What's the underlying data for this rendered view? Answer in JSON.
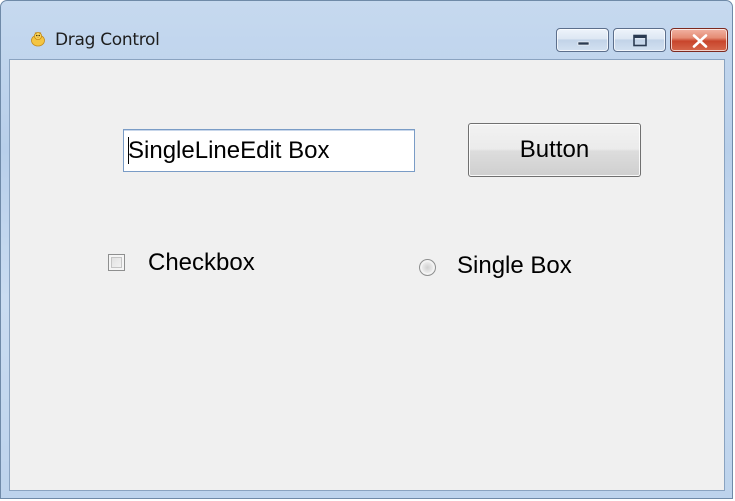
{
  "window": {
    "title": "Drag Control",
    "icon": "app-chick-icon",
    "caption_buttons": [
      "minimize-icon",
      "maximize-icon",
      "close-icon"
    ]
  },
  "content": {
    "edit_box": {
      "value": "SingleLineEdit Box"
    },
    "button": {
      "label": "Button"
    },
    "checkbox": {
      "label": "Checkbox",
      "checked": false
    },
    "radio": {
      "label": "Single Box",
      "selected": false
    }
  },
  "colors": {
    "frame": "#b9d1ea",
    "client_bg": "#f0f0f0",
    "close_button": "#c8452c"
  }
}
